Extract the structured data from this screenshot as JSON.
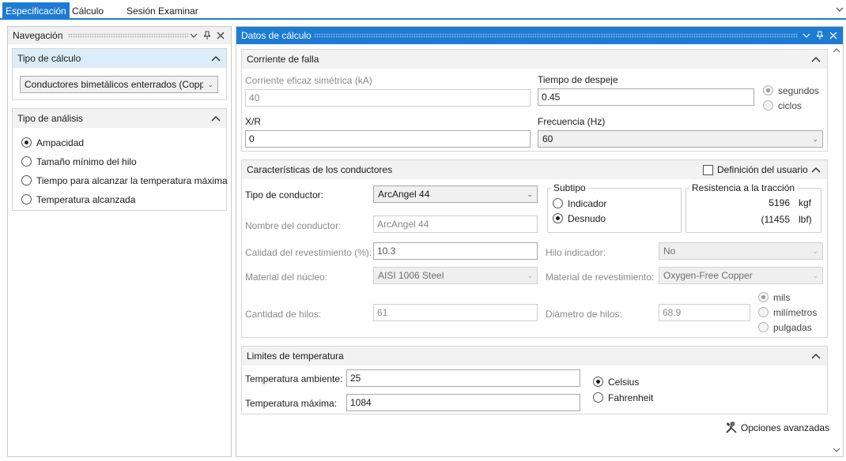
{
  "tabs": [
    {
      "label": "Especificación",
      "active": true
    },
    {
      "label": "Cálculo",
      "active": false
    },
    {
      "label": "Sesión Examinar",
      "active": false
    }
  ],
  "navigation": {
    "title": "Navegación",
    "calc_type": {
      "title": "Tipo de cálculo",
      "selected": "Conductores bimetálicos enterrados (Copper-clad steel)"
    },
    "analysis": {
      "title": "Tipo de análisis",
      "options": [
        {
          "label": "Ampacidad",
          "selected": true
        },
        {
          "label": "Tamaño mínimo del hilo",
          "selected": false
        },
        {
          "label": "Tiempo para alcanzar la temperatura máxima",
          "selected": false
        },
        {
          "label": "Temperatura alcanzada",
          "selected": false
        }
      ]
    }
  },
  "calc": {
    "title": "Datos de cálculo",
    "fault": {
      "title": "Corriente de falla",
      "current_label": "Corriente eficaz simétrica (kA)",
      "current_value": "40",
      "clear_time_label": "Tiempo de despeje",
      "clear_time_value": "0.45",
      "units": [
        {
          "label": "segundos",
          "selected": true
        },
        {
          "label": "ciclos",
          "selected": false
        }
      ],
      "xr_label": "X/R",
      "xr_value": "0",
      "freq_label": "Frecuencia (Hz)",
      "freq_value": "60"
    },
    "conductor": {
      "title": "Características de los conductores",
      "user_def_label": "Definición del usuario",
      "type_label": "Tipo de conductor:",
      "type_value": "ArcAngel 44",
      "subtype_title": "Subtipo",
      "subtypes": [
        {
          "label": "Indicador",
          "selected": false
        },
        {
          "label": "Desnudo",
          "selected": true
        }
      ],
      "tensile_title": "Resistencia a la tracción",
      "tensile_kgf_value": "5196",
      "tensile_kgf_unit": "kgf",
      "tensile_lbf_value": "(11455",
      "tensile_lbf_unit": "lbf)",
      "name_label": "Nombre del conductor:",
      "name_value": "ArcAngel 44",
      "coating_quality_label": "Calidad del revestimiento (%):",
      "coating_quality_value": "10.3",
      "indicator_wire_label": "Hilo indicador:",
      "indicator_wire_value": "No",
      "core_material_label": "Material del núcleo:",
      "core_material_value": "AISI 1006 Steel",
      "coating_material_label": "Material de revestimiento:",
      "coating_material_value": "Oxygen-Free Copper",
      "strand_count_label": "Cantidad de hilos:",
      "strand_count_value": "61",
      "strand_diameter_label": "Diámetro de hilos:",
      "strand_diameter_value": "68.9",
      "diameter_units": [
        {
          "label": "mils",
          "selected": true
        },
        {
          "label": "milímetros",
          "selected": false
        },
        {
          "label": "pulgadas",
          "selected": false
        }
      ]
    },
    "temps": {
      "title": "Limites de temperatura",
      "ambient_label": "Temperatura ambiente:",
      "ambient_value": "25",
      "max_label": "Temperatura máxima:",
      "max_value": "1084",
      "units": [
        {
          "label": "Celsius",
          "selected": true
        },
        {
          "label": "Fahrenheit",
          "selected": false
        }
      ]
    },
    "advanced_label": "Opciones avanzadas"
  },
  "colors": {
    "accent": "#1e7bd4",
    "section_header": "#dcedf9"
  }
}
